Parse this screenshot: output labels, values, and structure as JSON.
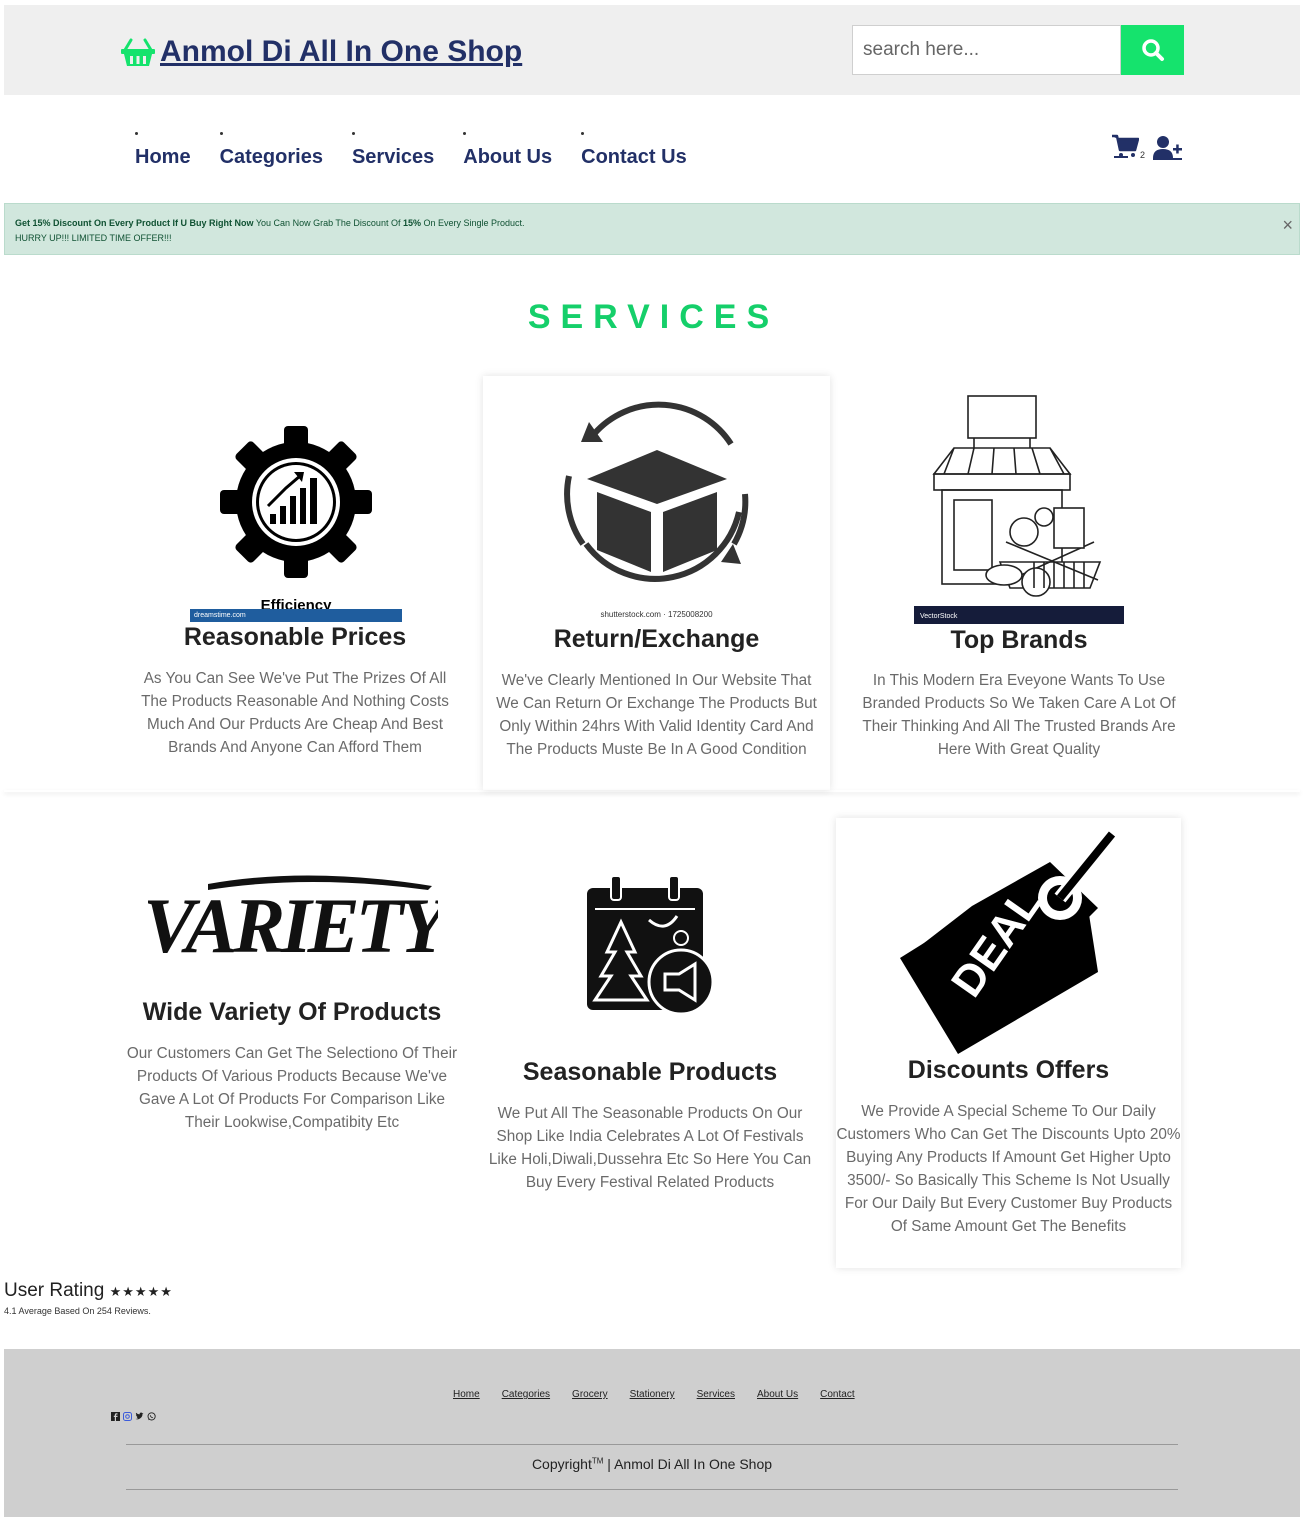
{
  "header": {
    "brand_title": "Anmol Di All In One Shop",
    "search_placeholder": "search here..."
  },
  "nav": {
    "items": [
      "Home",
      "Categories",
      "Services",
      "About Us",
      "Contact Us"
    ],
    "cart_count": "2"
  },
  "alert": {
    "bold1": "Get 15% Discount On Every Product If U Buy Right Now",
    "text1": " You Can Now Grab The Discount Of ",
    "bold2": "15%",
    "text2": " On Every Single Product.",
    "line2": "HURRY UP!!! LIMITED TIME OFFER!!!",
    "close": "×"
  },
  "services": {
    "heading": "SERVICES",
    "cards": [
      {
        "title": "Reasonable Prices",
        "desc": "As You Can See We've Put The Prizes Of All The Products Reasonable And Nothing Costs Much And Our Prducts Are Cheap And Best Brands And Anyone Can Afford Them",
        "img_caption": "Efficiency",
        "img_watermark": "dreamstime.com"
      },
      {
        "title": "Return/Exchange",
        "desc": "We've Clearly Mentioned In Our Website That We Can Return Or Exchange The Products But Only Within 24hrs With Valid Identity Card And The Products Muste Be In A Good Condition",
        "img_watermark": "shutterstock.com · 1725008200"
      },
      {
        "title": "Top Brands",
        "desc": "In This Modern Era Eveyone Wants To Use Branded Products So We Taken Care A Lot Of Their Thinking And All The Trusted Brands Are Here With Great Quality",
        "img_watermark": "VectorStock"
      },
      {
        "title": "Wide Variety Of Products",
        "desc": "Our Customers Can Get The Selectiono Of Their Products Of Various Products Because We've Gave A Lot Of Products For Comparison Like Their Lookwise,Compatibity Etc",
        "img_text": "VARIETY"
      },
      {
        "title": "Seasonable Products",
        "desc": "We Put All The Seasonable Products On Our Shop Like India Celebrates A Lot Of Festivals Like Holi,Diwali,Dussehra Etc So Here You Can Buy Every Festival Related Products"
      },
      {
        "title": "Discounts Offers",
        "desc": "We Provide A Special Scheme To Our Daily Customers Who Can Get The Discounts Upto 20% Buying Any Products If Amount Get Higher Upto 3500/- So Basically This Scheme Is Not Usually For Our Daily But Every Customer Buy Products Of Same Amount Get The Benefits",
        "img_text": "DEAL"
      }
    ]
  },
  "rating": {
    "title": "User Rating",
    "stars": "★★★★★",
    "summary": "4.1 Average Based On 254 Reviews."
  },
  "footer": {
    "links": [
      "Home",
      "Categories",
      "Grocery",
      "Stationery",
      "Services",
      "About Us",
      "Contact"
    ],
    "copyright_pre": "Copyright",
    "copyright_sup": "TM",
    "copyright_post": " | Anmol Di All In One Shop"
  },
  "colors": {
    "accent_green": "#15e36d",
    "brand_navy": "#223067",
    "alert_bg": "#d1e7dd"
  }
}
